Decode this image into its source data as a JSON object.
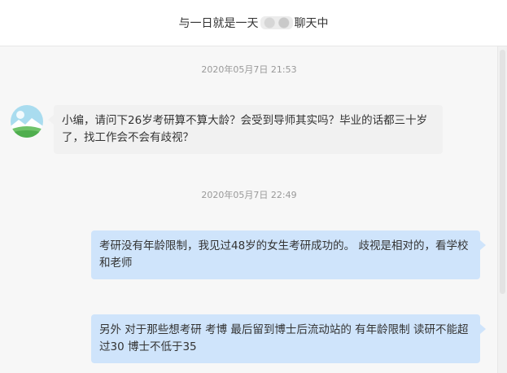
{
  "header": {
    "title_prefix": "与一日就是一天",
    "title_suffix": "聊天中"
  },
  "messages": [
    {
      "type": "timestamp",
      "text": "2020年05月7日 21:53"
    },
    {
      "type": "received",
      "text": "小编，请问下26岁考研算不算大龄？会受到导师其实吗？毕业的话都三十岁了，找工作会不会有歧视？"
    },
    {
      "type": "timestamp",
      "text": "2020年05月7日 22:49"
    },
    {
      "type": "sent",
      "text": "考研没有年龄限制，我见过48岁的女生考研成功的。 歧视是相对的，看学校和老师"
    },
    {
      "type": "sent",
      "text": "另外 对于那些想考研 考博 最后留到博士后流动站的 有年龄限制 读研不能超过30 博士不低于35"
    }
  ],
  "colors": {
    "sent_bubble": "#cfe4fb",
    "received_bubble": "#f1f1f1",
    "timestamp": "#999999"
  }
}
